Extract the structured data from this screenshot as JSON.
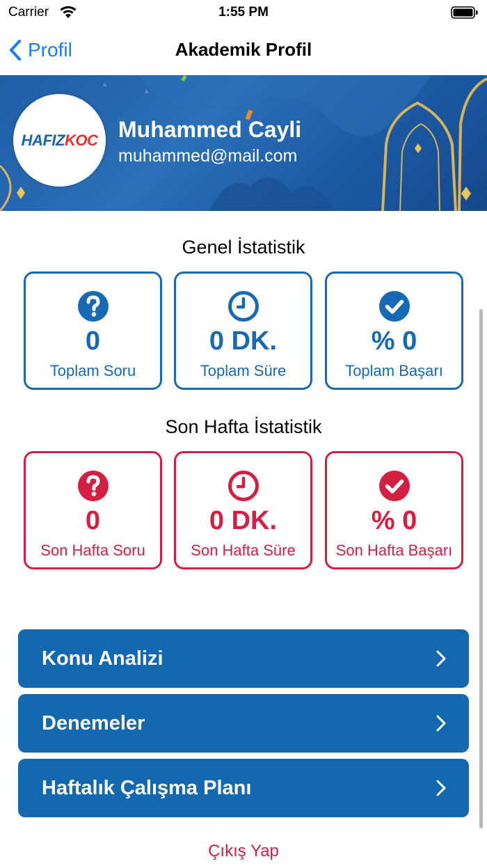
{
  "status_bar": {
    "carrier": "Carrier",
    "time": "1:55 PM"
  },
  "nav": {
    "back_label": "Profil",
    "title": "Akademik Profil"
  },
  "profile": {
    "logo_part1": "HAFIZ",
    "logo_part2": "KOC",
    "name": "Muhammed Cayli",
    "email": "muhammed@mail.com"
  },
  "general_stats": {
    "title": "Genel İstatistik",
    "cards": [
      {
        "icon": "question-circle-icon",
        "value": "0",
        "label": "Toplam Soru"
      },
      {
        "icon": "clock-icon",
        "value": "0 DK.",
        "label": "Toplam Süre"
      },
      {
        "icon": "check-circle-icon",
        "value": "% 0",
        "label": "Toplam Başarı"
      }
    ]
  },
  "week_stats": {
    "title": "Son Hafta İstatistik",
    "cards": [
      {
        "icon": "question-circle-icon",
        "value": "0",
        "label": "Son Hafta Soru"
      },
      {
        "icon": "clock-icon",
        "value": "0 DK.",
        "label": "Son Hafta Süre"
      },
      {
        "icon": "check-circle-icon",
        "value": "% 0",
        "label": "Son Hafta Başarı"
      }
    ]
  },
  "menu": [
    {
      "label": "Konu Analizi"
    },
    {
      "label": "Denemeler"
    },
    {
      "label": "Haftalık Çalışma Planı"
    }
  ],
  "logout_label": "Çıkış Yap",
  "colors": {
    "primary_blue": "#1769b4",
    "accent_red": "#d21f42",
    "link_blue": "#1b7cf3"
  }
}
